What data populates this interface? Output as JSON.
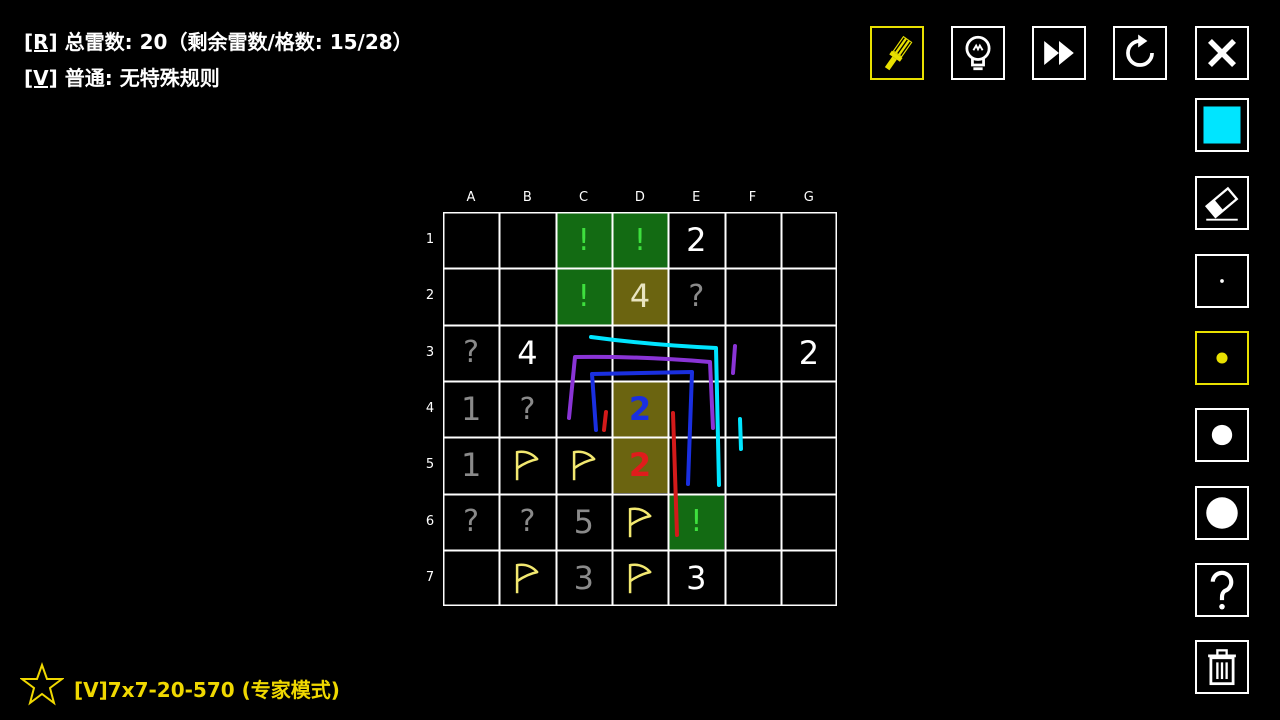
{
  "info": {
    "line1_tag": "[R]",
    "line1_text": " 总雷数: 20（剩余雷数/格数: 15/28）",
    "line2_tag": "[V]",
    "line2_text": " 普通: 无特殊规则"
  },
  "board": {
    "columns": [
      "A",
      "B",
      "C",
      "D",
      "E",
      "F",
      "G"
    ],
    "rows": [
      "1",
      "2",
      "3",
      "4",
      "5",
      "6",
      "7"
    ],
    "cells": [
      [
        {
          "t": ""
        },
        {
          "t": ""
        },
        {
          "t": "!",
          "k": "safe"
        },
        {
          "t": "!",
          "k": "safe"
        },
        {
          "t": "2",
          "k": "num"
        },
        {
          "t": ""
        },
        {
          "t": ""
        }
      ],
      [
        {
          "t": ""
        },
        {
          "t": ""
        },
        {
          "t": "!",
          "k": "safe"
        },
        {
          "t": "4",
          "k": "hl"
        },
        {
          "t": "?",
          "k": "q"
        },
        {
          "t": ""
        },
        {
          "t": ""
        }
      ],
      [
        {
          "t": "?",
          "k": "q"
        },
        {
          "t": "4",
          "k": "num"
        },
        {
          "t": ""
        },
        {
          "t": ""
        },
        {
          "t": ""
        },
        {
          "t": ""
        },
        {
          "t": "2",
          "k": "num"
        }
      ],
      [
        {
          "t": "1",
          "k": "dim"
        },
        {
          "t": "?",
          "k": "q"
        },
        {
          "t": ""
        },
        {
          "t": "2",
          "k": "hl2"
        },
        {
          "t": ""
        },
        {
          "t": ""
        },
        {
          "t": ""
        }
      ],
      [
        {
          "t": "1",
          "k": "dim"
        },
        {
          "t": "flag",
          "k": "flag"
        },
        {
          "t": "flag",
          "k": "flag"
        },
        {
          "t": "2",
          "k": "hl3"
        },
        {
          "t": ""
        },
        {
          "t": ""
        },
        {
          "t": ""
        }
      ],
      [
        {
          "t": "?",
          "k": "q"
        },
        {
          "t": "?",
          "k": "q"
        },
        {
          "t": "5",
          "k": "dim"
        },
        {
          "t": "flag",
          "k": "flag"
        },
        {
          "t": "!",
          "k": "safe"
        },
        {
          "t": ""
        },
        {
          "t": ""
        }
      ],
      [
        {
          "t": ""
        },
        {
          "t": "flag",
          "k": "flag"
        },
        {
          "t": "3",
          "k": "dim"
        },
        {
          "t": "flag",
          "k": "flag"
        },
        {
          "t": "3",
          "k": "num"
        },
        {
          "t": ""
        },
        {
          "t": ""
        }
      ]
    ]
  },
  "colors": {
    "safe_bg": "#136b13",
    "safe_fg": "#3ee03e",
    "hl_bg": "#6b6410",
    "flag": "#f2e870",
    "dim": "#8a8a8a",
    "q": "#8a8a8a",
    "accent": "#e8e000",
    "cyan": "#00e5ff"
  },
  "toolbar": {
    "top": [
      "brush-icon",
      "lightbulb-icon",
      "fast-forward-icon",
      "restart-icon",
      "close-icon"
    ],
    "side": [
      "color-swatch-icon",
      "eraser-icon",
      "dot-tiny-icon",
      "dot-small-icon",
      "dot-medium-icon",
      "dot-large-icon",
      "question-icon",
      "trash-icon"
    ]
  },
  "footer": {
    "label": "[V]7x7-20-570 (专家模式)"
  }
}
